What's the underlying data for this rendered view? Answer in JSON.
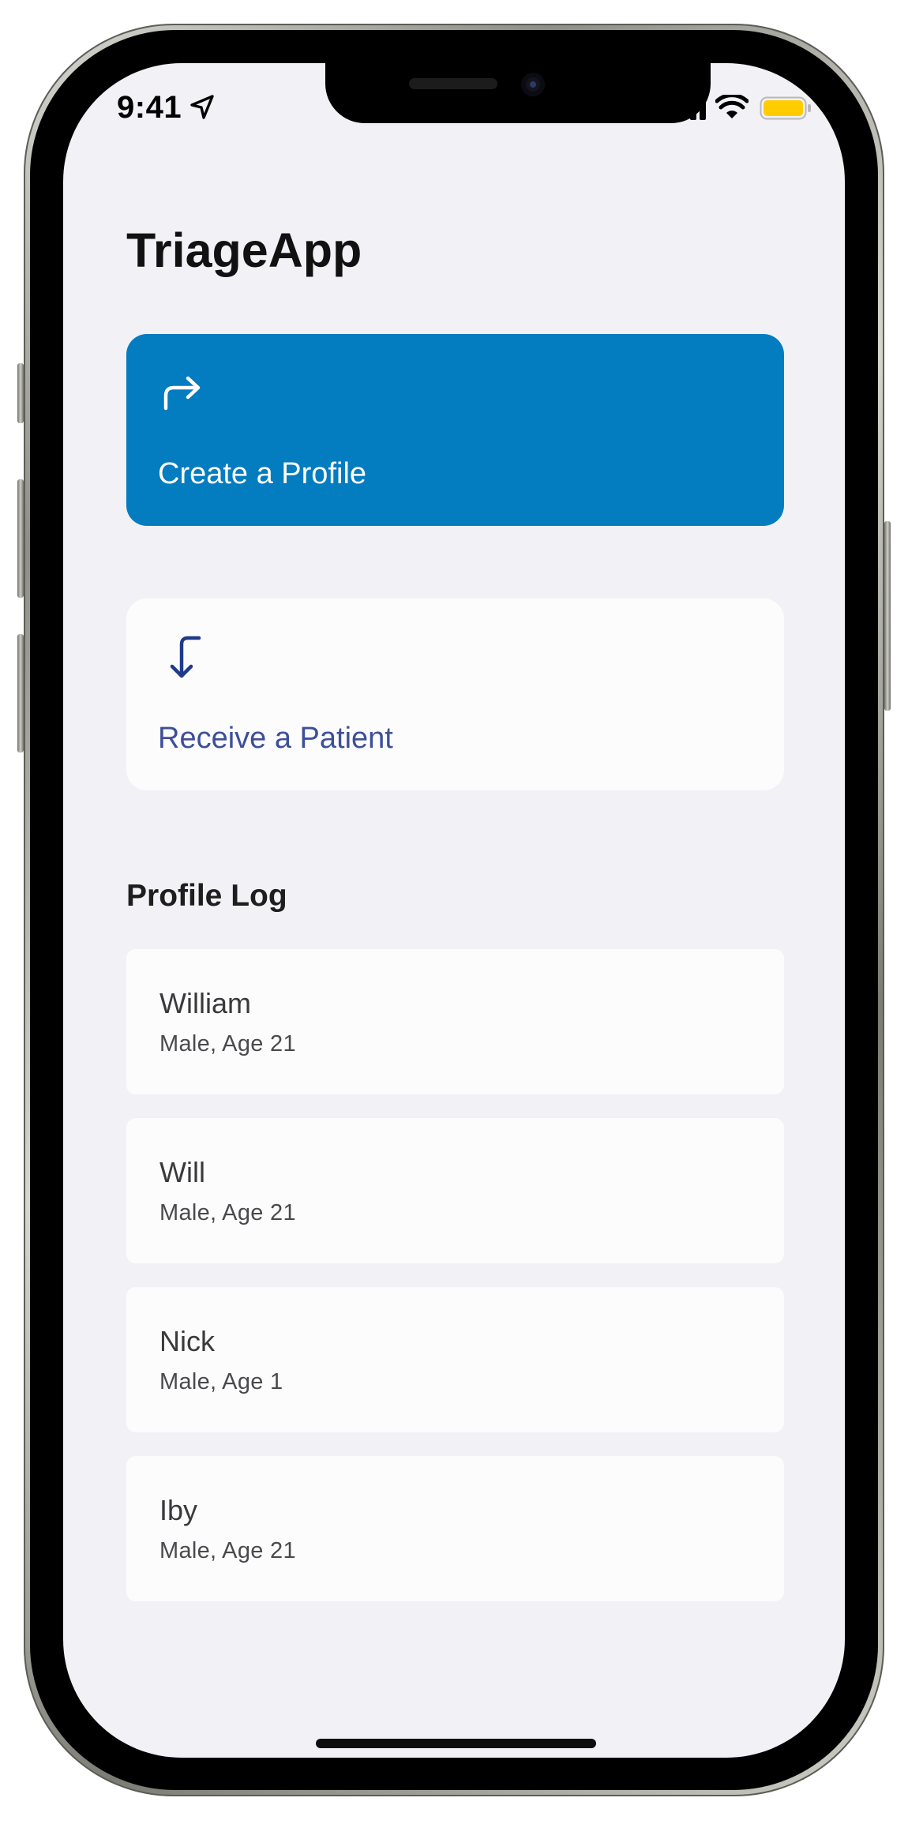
{
  "status_bar": {
    "time": "9:41",
    "location_icon": "location-arrow-icon",
    "signal_icon": "cellular-signal-icon",
    "wifi_icon": "wifi-icon",
    "battery_icon": "battery-icon",
    "battery_color": "#ffcc00"
  },
  "header": {
    "title": "TriageApp"
  },
  "actions": {
    "create": {
      "label": "Create a Profile",
      "icon": "arrow-turn-up-right-icon",
      "background": "#037cc0"
    },
    "receive": {
      "label": "Receive a Patient",
      "icon": "arrow-turn-down-left-icon",
      "accent": "#3d4f9a"
    }
  },
  "profile_log": {
    "title": "Profile Log",
    "items": [
      {
        "name": "William",
        "details": "Male, Age 21"
      },
      {
        "name": "Will",
        "details": "Male, Age 21"
      },
      {
        "name": "Nick",
        "details": "Male, Age 1"
      },
      {
        "name": "Iby",
        "details": "Male, Age 21"
      }
    ]
  }
}
